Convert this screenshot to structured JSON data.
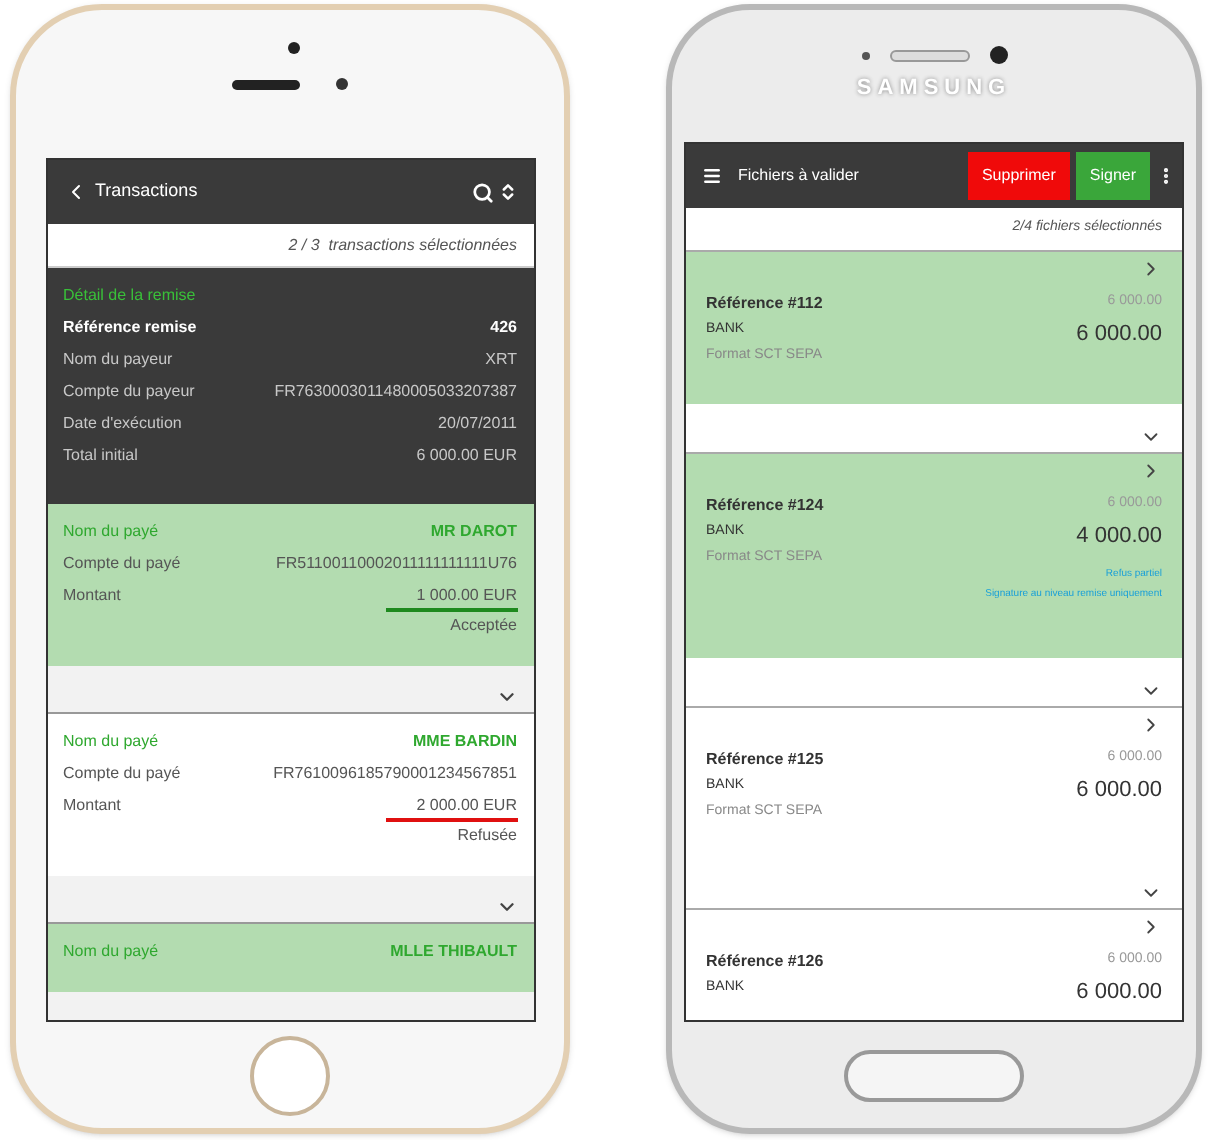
{
  "left_phone": {
    "header": {
      "title": "Transactions"
    },
    "selection_count": "2 / 3  transactions sélectionnées",
    "detail": {
      "heading": "Détail de la remise",
      "rows": [
        {
          "kind": "emphasis",
          "label": "Référence remise",
          "value": "426"
        },
        {
          "kind": "plain",
          "label": "Nom du payeur",
          "value": "XRT"
        },
        {
          "kind": "plain",
          "label": "Compte du payeur",
          "value": "FR7630003011480005033207387"
        },
        {
          "kind": "plain",
          "label": "Date d'exécution",
          "value": "20/07/2011"
        },
        {
          "kind": "plain",
          "label": "Total initial",
          "value": "6 000.00 EUR"
        }
      ]
    },
    "payees": [
      {
        "selected": true,
        "label": "Nom du payé",
        "name": "MR DAROT",
        "account_label": "Compte du payé",
        "account": "FR51100110002011111111111U76",
        "amount_label": "Montant",
        "amount": "1 000.00 EUR",
        "status": "Acceptée",
        "color": "#1e8a1e"
      },
      {
        "selected": false,
        "label": "Nom du payé",
        "name": "MME BARDIN",
        "account_label": "Compte du payé",
        "account": "FR7610096185790001234567851",
        "amount_label": "Montant",
        "amount": "2 000.00 EUR",
        "status": "Refusée",
        "color": "#e01010"
      },
      {
        "selected": true,
        "label": "Nom du payé",
        "name": "MLLE THIBAULT"
      }
    ]
  },
  "right_phone": {
    "brand": "SAMSUNG",
    "header": {
      "title": "Fichiers à valider"
    },
    "buttons": [
      {
        "kind": "danger",
        "label": "Supprimer"
      },
      {
        "kind": "confirm",
        "label": "Signer"
      }
    ],
    "selection_count": "2/4 fichiers sélectionnés",
    "files": [
      {
        "selected": true,
        "reference": "Référence #112",
        "bank": "BANK",
        "format": "Format SCT SEPA",
        "original": "6 000.00",
        "amount": "6 000.00"
      },
      {
        "selected": true,
        "reference": "Référence #124",
        "bank": "BANK",
        "format": "Format SCT SEPA",
        "original": "6 000.00",
        "amount": "4 000.00",
        "notes": [
          "Refus partiel",
          "Signature au niveau remise uniquement"
        ]
      },
      {
        "selected": false,
        "reference": "Référence #125",
        "bank": "BANK",
        "format": "Format SCT SEPA",
        "original": "6 000.00",
        "amount": "6 000.00"
      },
      {
        "selected": false,
        "reference": "Référence #126",
        "bank": "BANK",
        "original": "6 000.00",
        "amount": "6 000.00"
      }
    ]
  }
}
